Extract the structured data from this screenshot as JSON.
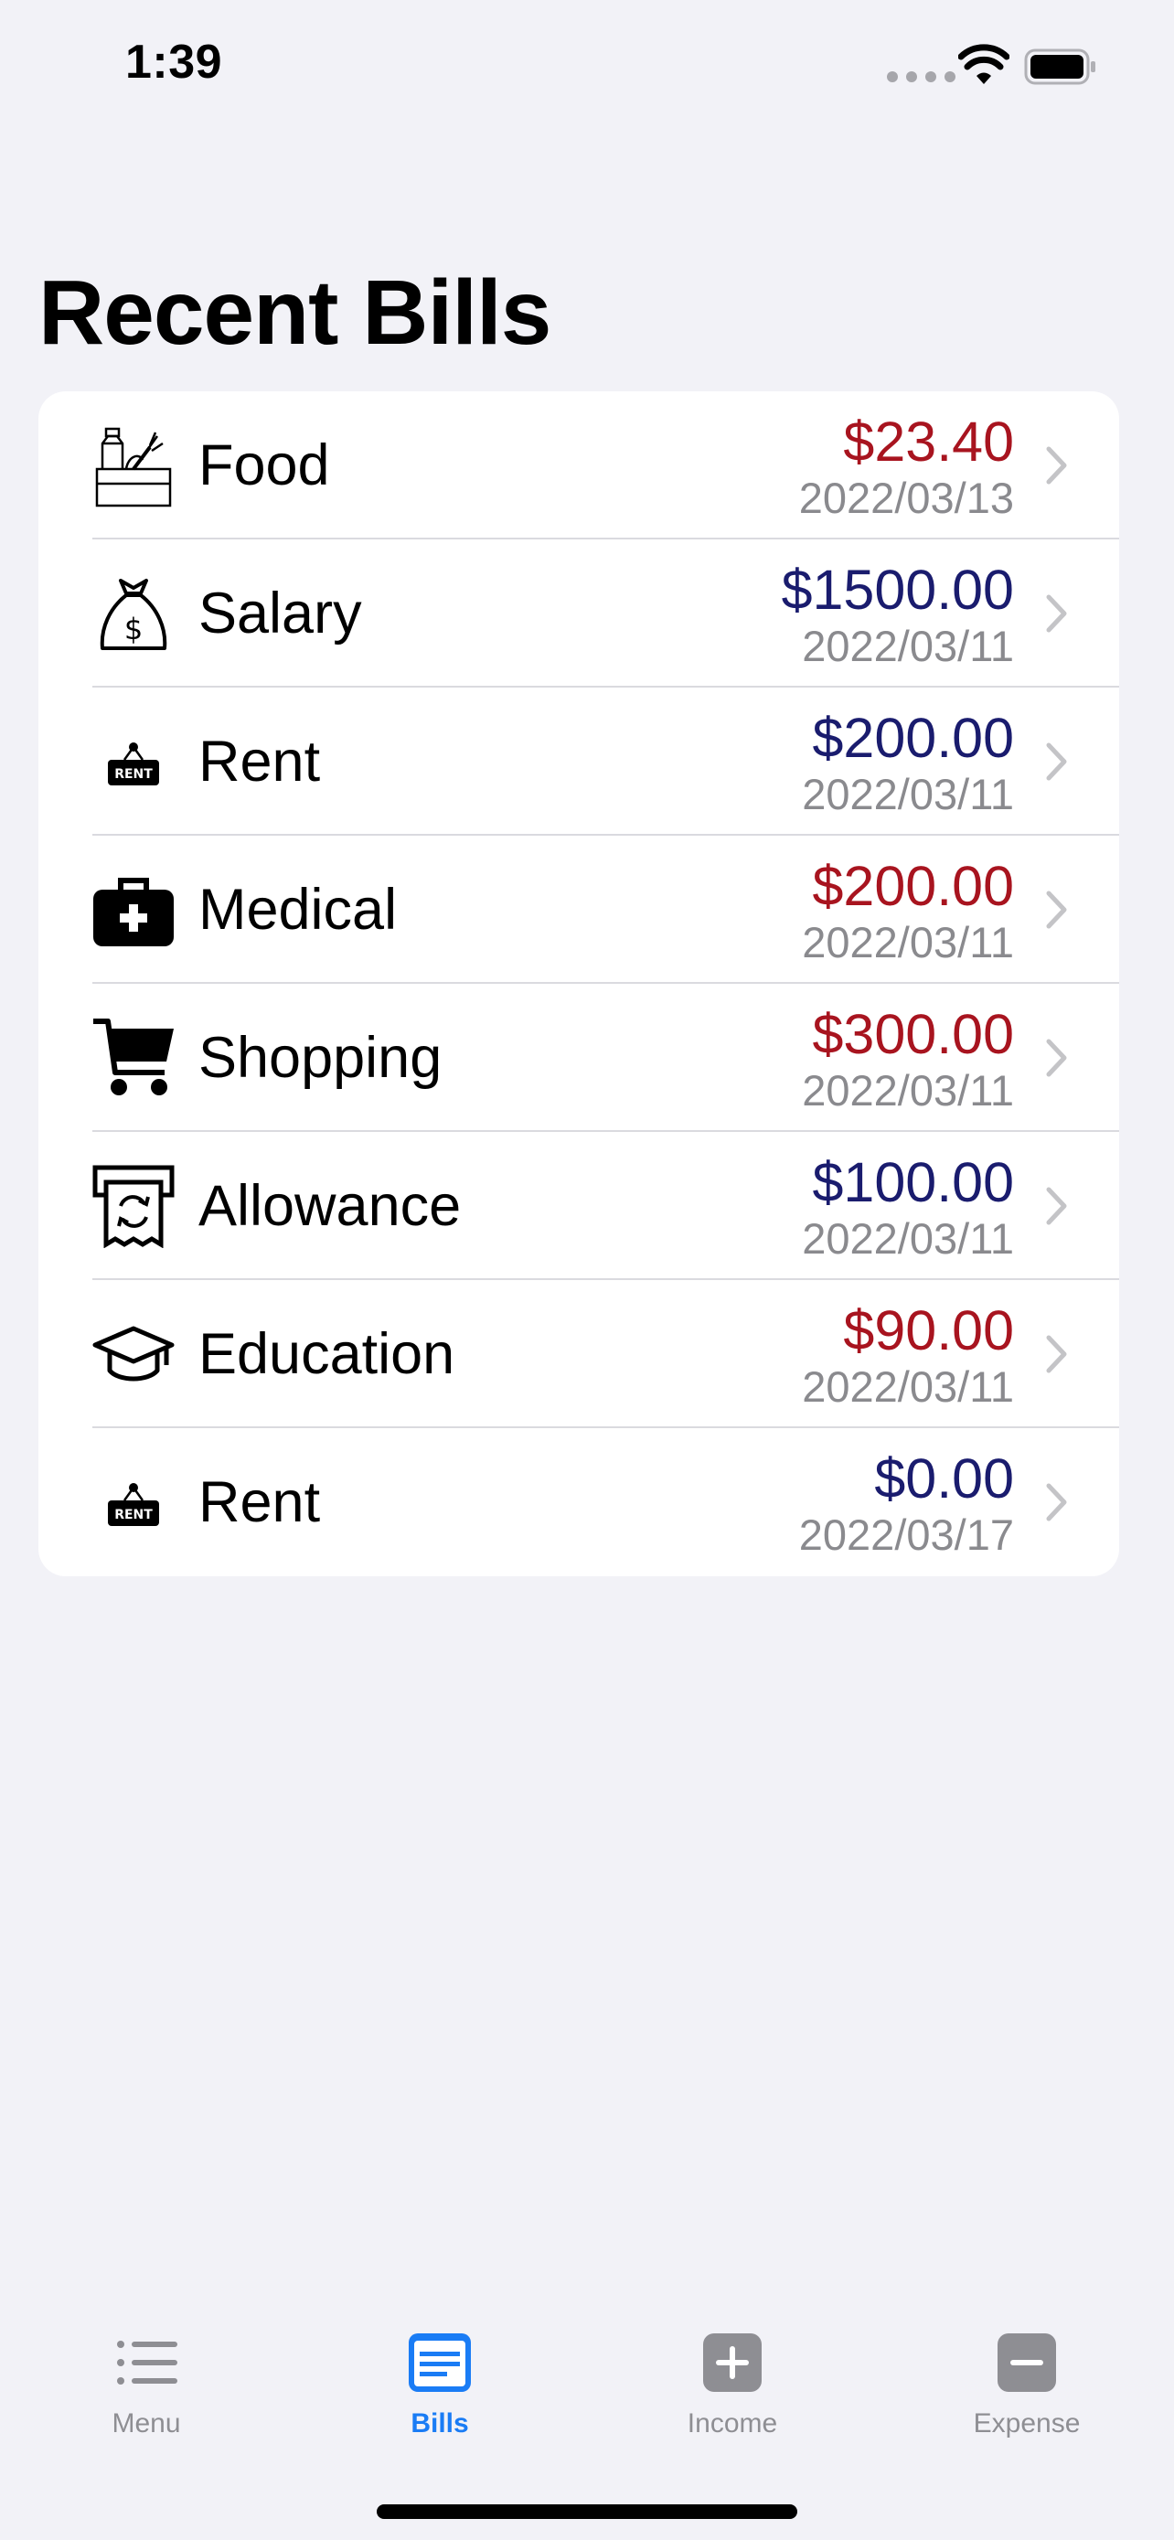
{
  "status_bar": {
    "time": "1:39"
  },
  "page": {
    "title": "Recent Bills"
  },
  "bills": [
    {
      "category": "Food",
      "icon": "grocery-icon",
      "amount": "$23.40",
      "date": "2022/03/13",
      "type": "expense"
    },
    {
      "category": "Salary",
      "icon": "money-bag-icon",
      "amount": "$1500.00",
      "date": "2022/03/11",
      "type": "income"
    },
    {
      "category": "Rent",
      "icon": "rent-sign-icon",
      "amount": "$200.00",
      "date": "2022/03/11",
      "type": "income"
    },
    {
      "category": "Medical",
      "icon": "medical-kit-icon",
      "amount": "$200.00",
      "date": "2022/03/11",
      "type": "expense"
    },
    {
      "category": "Shopping",
      "icon": "shopping-cart-icon",
      "amount": "$300.00",
      "date": "2022/03/11",
      "type": "expense"
    },
    {
      "category": "Allowance",
      "icon": "allowance-receipt-icon",
      "amount": "$100.00",
      "date": "2022/03/11",
      "type": "income"
    },
    {
      "category": "Education",
      "icon": "graduation-cap-icon",
      "amount": "$90.00",
      "date": "2022/03/11",
      "type": "expense"
    },
    {
      "category": "Rent",
      "icon": "rent-sign-icon",
      "amount": "$0.00",
      "date": "2022/03/17",
      "type": "income"
    }
  ],
  "rent_sign_text": "RENT",
  "tabs": [
    {
      "label": "Menu",
      "icon": "list-icon",
      "active": false
    },
    {
      "label": "Bills",
      "icon": "bills-icon",
      "active": true
    },
    {
      "label": "Income",
      "icon": "plus-square-icon",
      "active": false
    },
    {
      "label": "Expense",
      "icon": "minus-square-icon",
      "active": false
    }
  ],
  "colors": {
    "expense": "#a8141f",
    "income": "#1a1c6e",
    "accent": "#1a7cf5",
    "inactive": "#8e8e93",
    "background": "#f2f2f7"
  }
}
